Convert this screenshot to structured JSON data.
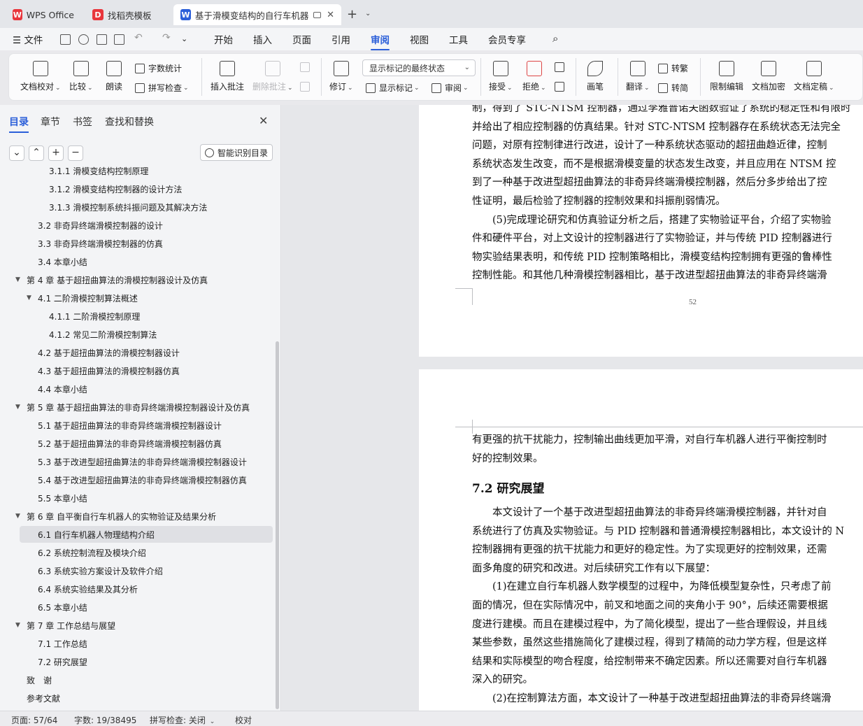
{
  "titlebar": {
    "tabs": [
      {
        "label": "WPS Office",
        "icon": "wps-logo-icon",
        "color": "#e8363c"
      },
      {
        "label": "找稻壳模板",
        "icon": "docer-logo-icon",
        "color": "#e8363c"
      },
      {
        "label": "基于滑模变结构的自行车机器人",
        "icon": "writer-logo-icon",
        "color": "#2b5fd9"
      }
    ],
    "new_tab": "+",
    "new_tab_menu": "⌄"
  },
  "menubar": {
    "file": "文件",
    "tabs": [
      "开始",
      "插入",
      "页面",
      "引用",
      "审阅",
      "视图",
      "工具",
      "会员专享"
    ],
    "active": "审阅"
  },
  "ribbon": {
    "doc_proof": "文档校对",
    "compare": "比较",
    "read_aloud": "朗读",
    "word_count": "字数统计",
    "spell_check": "拼写检查",
    "insert_comment": "插入批注",
    "delete_comment": "删除批注",
    "track_changes": "修订",
    "markup_dropdown": "显示标记的最终状态",
    "show_markup": "显示标记",
    "review": "审阅",
    "accept": "接受",
    "reject": "拒绝",
    "pen": "画笔",
    "translate": "翻译",
    "to_traditional": "转繁",
    "to_simplified": "转简",
    "restrict_edit": "限制编辑",
    "encrypt": "文档加密",
    "finalize": "文档定稿"
  },
  "nav": {
    "tabs": [
      "目录",
      "章节",
      "书签",
      "查找和替换"
    ],
    "active": "目录",
    "buttons": [
      "⌄",
      "⌃",
      "+",
      "−"
    ],
    "smart_toc": "智能识别目录",
    "items": [
      {
        "label": "3.1.1 滑模变结构控制原理",
        "level": 3
      },
      {
        "label": "3.1.2  滑模变结构控制器的设计方法",
        "level": 3
      },
      {
        "label": "3.1.3 滑模控制系统抖振问题及其解决方法",
        "level": 3
      },
      {
        "label": "3.2  非奇异终端滑模控制器的设计",
        "level": 2
      },
      {
        "label": "3.3  非奇异终端滑模控制器的仿真",
        "level": 2
      },
      {
        "label": "3.4  本章小结",
        "level": 2
      },
      {
        "label": "第 4 章  基于超扭曲算法的滑模控制器设计及仿真",
        "level": 1,
        "expanded": true
      },
      {
        "label": "4.1  二阶滑模控制算法概述",
        "level": 2,
        "expanded": true
      },
      {
        "label": "4.1.1  二阶滑模控制原理",
        "level": 3
      },
      {
        "label": "4.1.2  常见二阶滑模控制算法",
        "level": 3
      },
      {
        "label": "4.2  基于超扭曲算法的滑模控制器设计",
        "level": 2
      },
      {
        "label": "4.3  基于超扭曲算法的滑模控制器仿真",
        "level": 2
      },
      {
        "label": "4.4  本章小结",
        "level": 2
      },
      {
        "label": "第 5 章  基于超扭曲算法的非奇异终端滑模控制器设计及仿真",
        "level": 1,
        "expanded": true
      },
      {
        "label": "5.1  基于超扭曲算法的非奇异终端滑模控制器设计",
        "level": 2
      },
      {
        "label": "5.2  基于超扭曲算法的非奇异终端滑模控制器仿真",
        "level": 2
      },
      {
        "label": "5.3  基于改进型超扭曲算法的非奇异终端滑模控制器设计",
        "level": 2
      },
      {
        "label": "5.4  基于改进型超扭曲算法的非奇异终端滑模控制器仿真",
        "level": 2
      },
      {
        "label": "5.5  本章小结",
        "level": 2
      },
      {
        "label": "第 6 章  自平衡自行车机器人的实物验证及结果分析",
        "level": 1,
        "expanded": true
      },
      {
        "label": "6.1  自行车机器人物理结构介绍",
        "level": 2,
        "selected": true
      },
      {
        "label": "6.2  系统控制流程及模块介绍",
        "level": 2
      },
      {
        "label": "6.3  系统实验方案设计及软件介绍",
        "level": 2
      },
      {
        "label": "6.4  系统实验结果及其分析",
        "level": 2
      },
      {
        "label": "6.5  本章小结",
        "level": 2
      },
      {
        "label": "第 7 章  工作总结与展望",
        "level": 1,
        "expanded": true
      },
      {
        "label": "7.1  工作总结",
        "level": 2
      },
      {
        "label": "7.2  研究展望",
        "level": 2
      },
      {
        "label": "致　谢",
        "level": 1
      },
      {
        "label": "参考文献",
        "level": 1
      }
    ]
  },
  "document": {
    "page1_lines": [
      "制，得到了 STC-NTSM 控制器，通过李雅普诺夫函数验证了系统的稳定性和有限时",
      "并给出了相应控制器的仿真结果。针对 STC-NTSM 控制器存在系统状态无法完全",
      "问题，对原有控制律进行改进，设计了一种系统状态驱动的超扭曲趋近律，控制",
      "系统状态发生改变，而不是根据滑模变量的状态发生改变，并且应用在 NTSM 控",
      "到了一种基于改进型超扭曲算法的非奇异终端滑模控制器，然后分多步给出了控",
      "性证明，最后检验了控制器的控制效果和抖振削弱情况。",
      "　　(5)完成理论研究和仿真验证分析之后，搭建了实物验证平台，介绍了实物验",
      "件和硬件平台，对上文设计的控制器进行了实物验证，并与传统 PID 控制器进行",
      "物实验结果表明，和传统 PID 控制策略相比，滑模变结构控制拥有更强的鲁棒性",
      "控制性能。和其他几种滑模控制器相比，基于改进型超扭曲算法的非奇异终端滑"
    ],
    "page_number": "52",
    "page2_lines_a": [
      "有更强的抗干扰能力，控制输出曲线更加平滑，对自行车机器人进行平衡控制时",
      "好的控制效果。"
    ],
    "heading": "7.2  研究展望",
    "page2_lines_b": [
      "　　本文设计了一个基于改进型超扭曲算法的非奇异终端滑模控制器，并针对自",
      "系统进行了仿真及实物验证。与 PID 控制器和普通滑模控制器相比，本文设计的 N",
      "控制器拥有更强的抗干扰能力和更好的稳定性。为了实现更好的控制效果，还需",
      "面多角度的研究和改进。对后续研究工作有以下展望：",
      "　　(1)在建立自行车机器人数学模型的过程中，为降低模型复杂性，只考虑了前",
      "面的情况，但在实际情况中，前叉和地面之间的夹角小于 90°，后续还需要根据",
      "度进行建模。而且在建模过程中，为了简化模型，提出了一些合理假设，并且线",
      "某些参数，虽然这些措施简化了建模过程，得到了精简的动力学方程，但是这样",
      "结果和实际模型的吻合程度，给控制带来不确定因素。所以还需要对自行车机器",
      "深入的研究。",
      "　　(2)在控制算法方面，本文设计了一种基于改进型超扭曲算法的非奇异终端滑"
    ]
  },
  "statusbar": {
    "page": "页面: 57/64",
    "words": "字数: 19/38495",
    "spell": "拼写检查: 关闭",
    "proof": "校对"
  }
}
